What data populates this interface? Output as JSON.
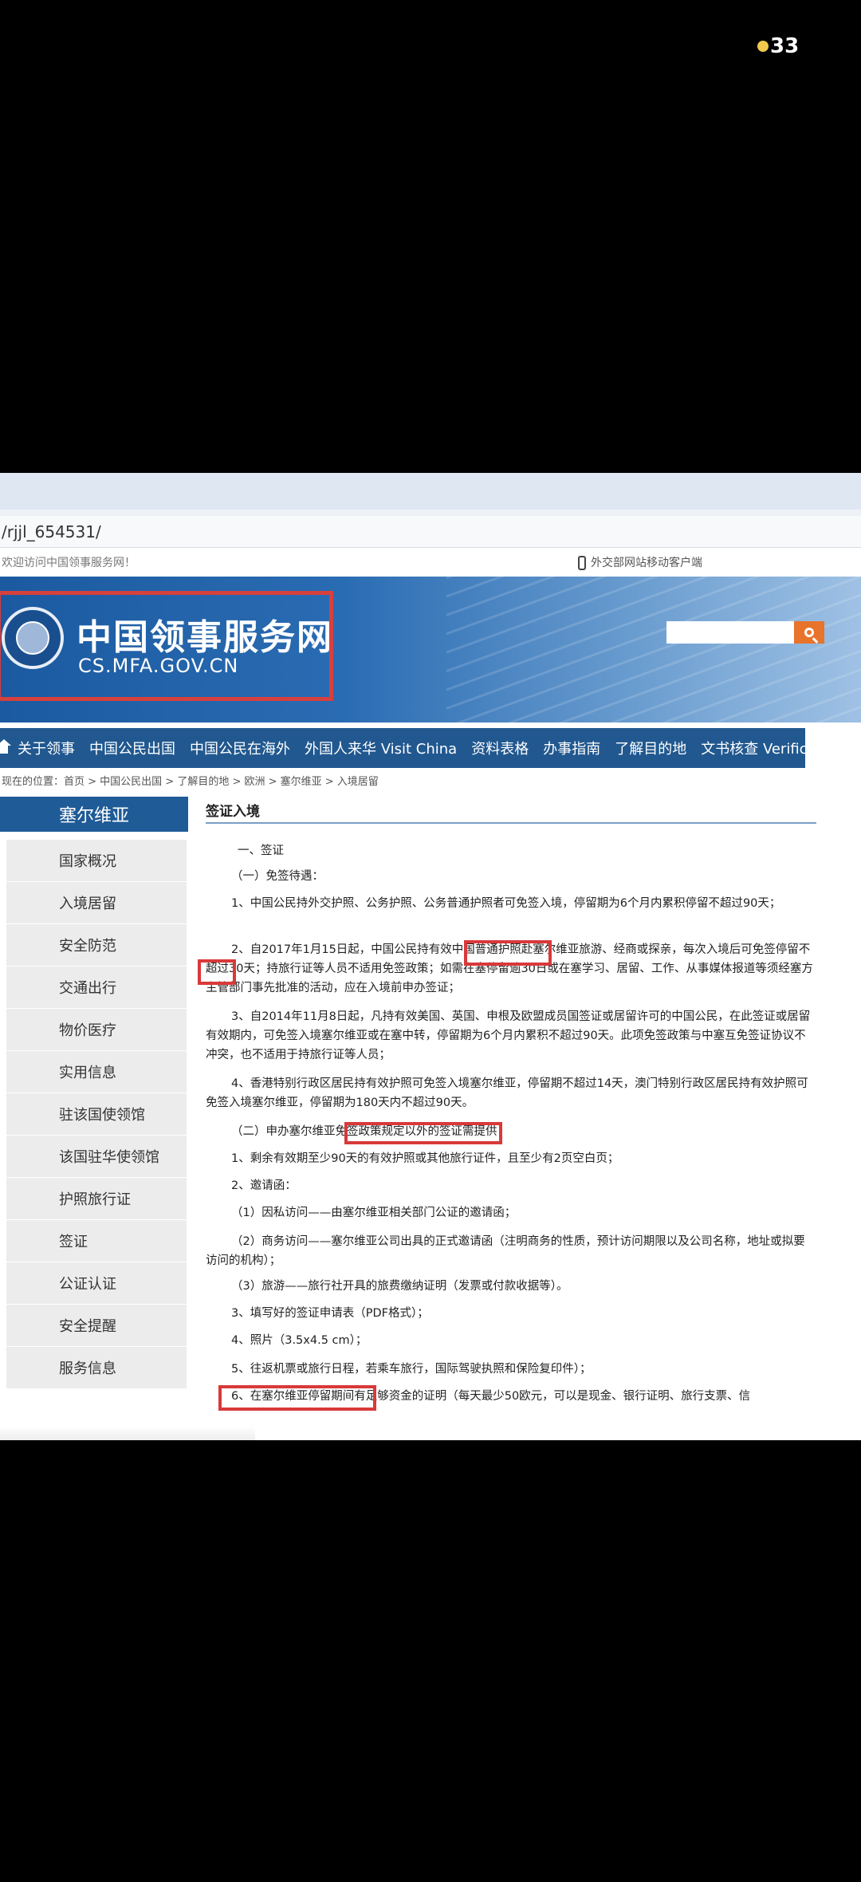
{
  "status_indicator": "33",
  "browser": {
    "url": "/rjjl_654531/"
  },
  "topbar": {
    "welcome": "欢迎访问中国领事服务网！",
    "mobile_client": "外交部网站移动客户端"
  },
  "site": {
    "title": "中国领事服务网",
    "domain": "CS.MFA.GOV.CN"
  },
  "nav": {
    "items": [
      "关于领事",
      "中国公民出国",
      "中国公民在海外",
      "外国人来华 Visit China",
      "资料表格",
      "办事指南",
      "了解目的地",
      "文书核查 Verification"
    ]
  },
  "breadcrumb": "现在的位置：首页 > 中国公民出国 > 了解目的地 > 欧洲 > 塞尔维亚 > 入境居留",
  "sidebar": {
    "title": "塞尔维亚",
    "items": [
      "国家概况",
      "入境居留",
      "安全防范",
      "交通出行",
      "物价医疗",
      "实用信息",
      "驻该国使领馆",
      "该国驻华使领馆",
      "护照旅行证",
      "签证",
      "公证认证",
      "安全提醒",
      "服务信息"
    ]
  },
  "content": {
    "title": "签证入境",
    "paragraphs": [
      "一、签证",
      "（一）免签待遇：",
      "1、中国公民持外交护照、公务护照、公务普通护照者可免签入境，停留期为6个月内累积停留不超过90天；",
      "2、自2017年1月15日起，中国公民持有效中国普通护照赴塞尔维亚旅游、经商或探亲，每次入境后可免签停留不超过30天；持旅行证等人员不适用免签政策；如需在塞停留逾30日或在塞学习、居留、工作、从事媒体报道等须经塞方主管部门事先批准的活动，应在入境前申办签证；",
      "3、自2014年11月8日起，凡持有效美国、英国、申根及欧盟成员国签证或居留许可的中国公民，在此签证或居留有效期内，可免签入境塞尔维亚或在塞中转，停留期为6个月内累积不超过90天。此项免签政策与中塞互免签证协议不冲突，也不适用于持旅行证等人员；",
      "4、香港特别行政区居民持有效护照可免签入境塞尔维亚，停留期不超过14天，澳门特别行政区居民持有效护照可免签入境塞尔维亚，停留期为180天内不超过90天。",
      "（二）申办塞尔维亚免签政策规定以外的签证需提供：",
      "1、剩余有效期至少90天的有效护照或其他旅行证件，且至少有2页空白页；",
      "2、邀请函：",
      "（1）因私访问——由塞尔维亚相关部门公证的邀请函；",
      "（2）商务访问——塞尔维亚公司出具的正式邀请函（注明商务的性质，预计访问期限以及公司名称，地址或拟要访问的机构）；",
      "（3）旅游——旅行社开具的旅费缴纳证明（发票或付款收据等）。",
      "3、填写好的签证申请表（PDF格式）；",
      "4、照片（3.5x4.5 cm）；",
      "5、往返机票或旅行日程，若乘车旅行，国际驾驶执照和保险复印件）；",
      "6、在塞尔维亚停留期间有足够资金的证明（每天最少50欧元，可以是现金、银行证明、旅行支票、信"
    ]
  }
}
